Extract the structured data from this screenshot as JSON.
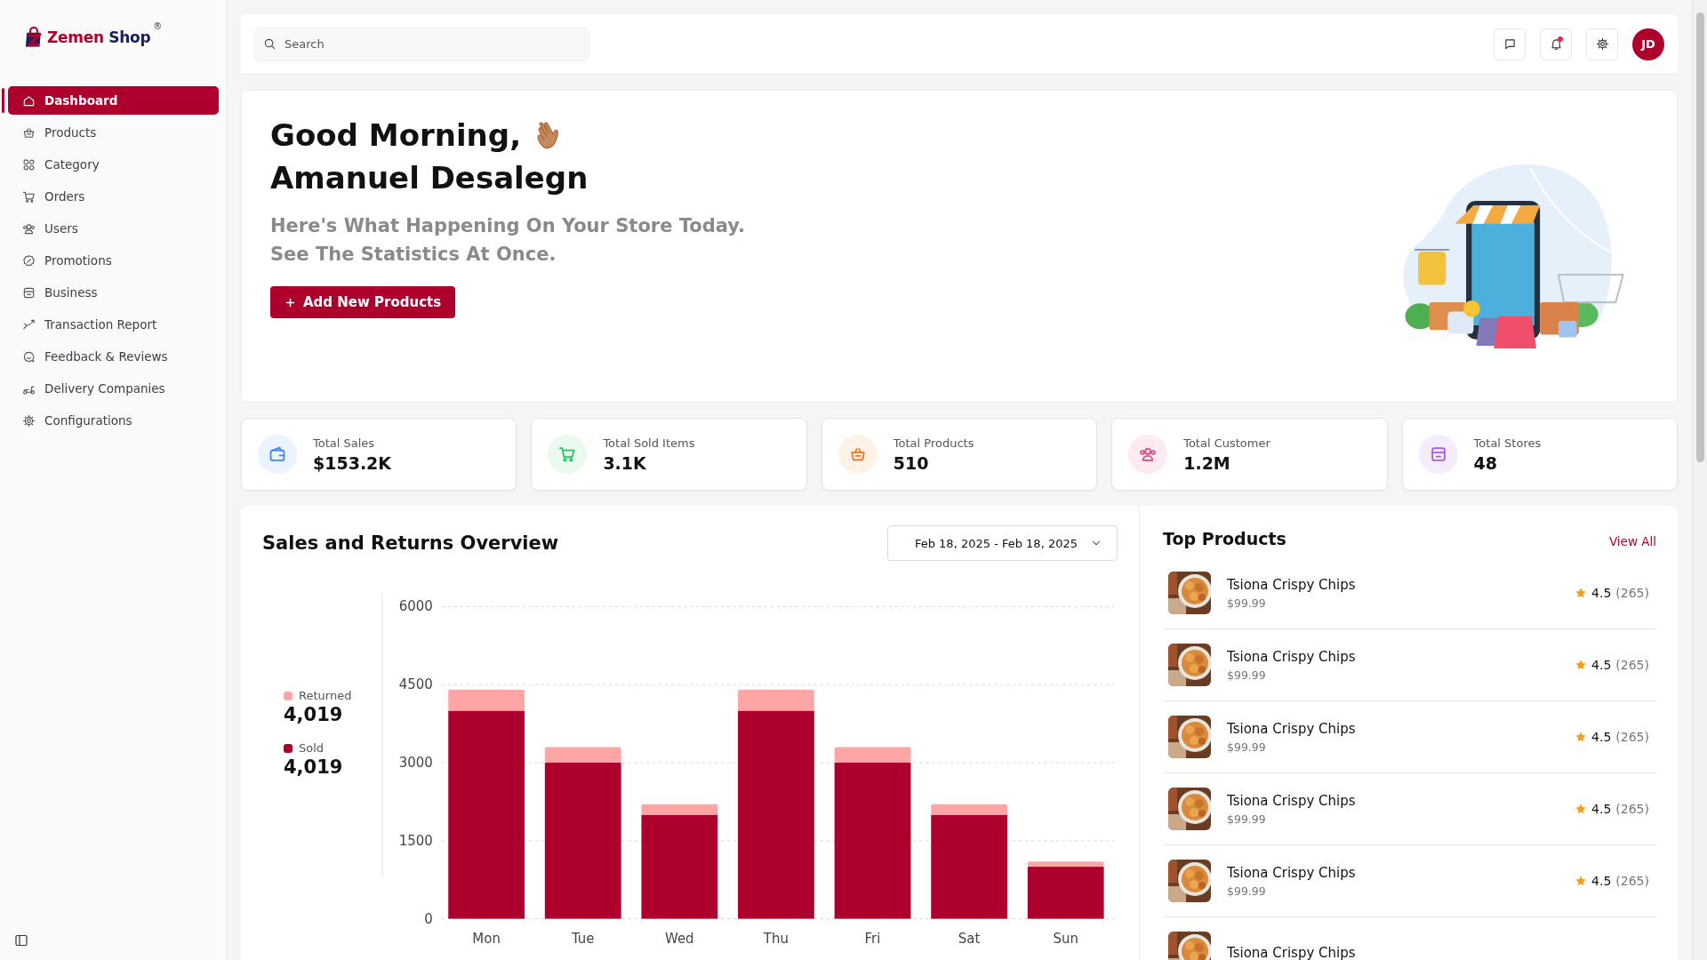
{
  "brand": {
    "name": [
      "Zemen",
      "Shop"
    ],
    "mark": "®"
  },
  "sidebar": {
    "items": [
      {
        "label": "Dashboard",
        "selected": true
      },
      {
        "label": "Products",
        "selected": false
      },
      {
        "label": "Category",
        "selected": false
      },
      {
        "label": "Orders",
        "selected": false
      },
      {
        "label": "Users",
        "selected": false
      },
      {
        "label": "Promotions",
        "selected": false
      },
      {
        "label": "Business",
        "selected": false
      },
      {
        "label": "Transaction Report",
        "selected": false
      },
      {
        "label": "Feedback & Reviews",
        "selected": false
      },
      {
        "label": "Delivery Companies",
        "selected": false
      },
      {
        "label": "Configurations",
        "selected": false
      }
    ]
  },
  "header": {
    "search": {
      "placeholder": "Search"
    },
    "notifications": {
      "unread": true
    },
    "avatar": "JD"
  },
  "hero": {
    "greeting": "Good Morning,",
    "name": "Amanuel Desalegn",
    "subtitle": [
      "Here's What Happening On Your Store Today.",
      "See The Statistics At Once."
    ],
    "button": "Add New Products"
  },
  "stats": [
    {
      "label": "Total Sales",
      "value": "$153.2K"
    },
    {
      "label": "Total Sold Items",
      "value": "3.1K"
    },
    {
      "label": "Total Products",
      "value": "510"
    },
    {
      "label": "Total Customer",
      "value": "1.2M"
    },
    {
      "label": "Total Stores",
      "value": "48"
    }
  ],
  "sales": {
    "title": "Sales and Returns Overview",
    "date_range": "Feb 18, 2025 - Feb 18, 2025",
    "legend": [
      {
        "value": "4,019"
      },
      {
        "value": "4,019"
      }
    ],
    "chart_data": {
      "type": "bar",
      "stacked": true,
      "categories": [
        "Mon",
        "Tue",
        "Wed",
        "Thu",
        "Fri",
        "Sat",
        "Sun"
      ],
      "series": [
        {
          "name": "Sold",
          "color": "#ad002c",
          "values": [
            4000,
            3000,
            2000,
            4000,
            3000,
            2000,
            1000
          ]
        },
        {
          "name": "Returned",
          "color": "#ffa5a5",
          "values": [
            400,
            300,
            200,
            400,
            300,
            200,
            100
          ]
        }
      ],
      "ylim": [
        0,
        6000
      ],
      "yticks": [
        0,
        1500,
        3000,
        4500,
        6000
      ],
      "grid": true
    }
  },
  "top_products": {
    "title": "Top Products",
    "link": "View All",
    "items": [
      {
        "name": "Tsiona Crispy Chips",
        "price": "$99.99",
        "rating": "4.5",
        "reviews": "(265)"
      },
      {
        "name": "Tsiona Crispy Chips",
        "price": "$99.99",
        "rating": "4.5",
        "reviews": "(265)"
      },
      {
        "name": "Tsiona Crispy Chips",
        "price": "$99.99",
        "rating": "4.5",
        "reviews": "(265)"
      },
      {
        "name": "Tsiona Crispy Chips",
        "price": "$99.99",
        "rating": "4.5",
        "reviews": "(265)"
      },
      {
        "name": "Tsiona Crispy Chips",
        "price": "$99.99",
        "rating": "4.5",
        "reviews": "(265)"
      },
      {
        "name": "Tsiona Crispy Chips"
      }
    ]
  }
}
